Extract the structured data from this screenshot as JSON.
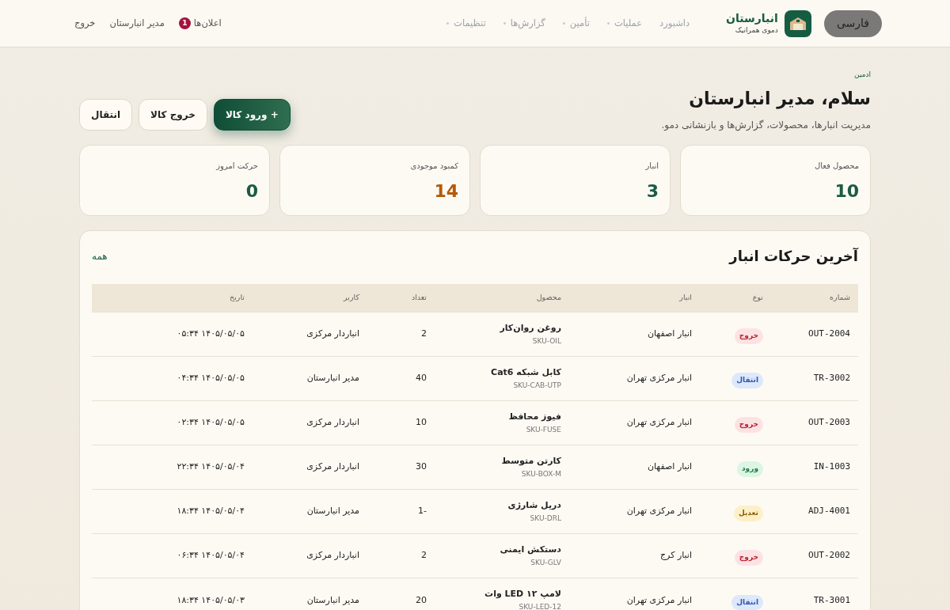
{
  "header": {
    "language_button": "فارسی",
    "brand": {
      "name": "انبارستان",
      "subtitle": "دموی همرانیک"
    },
    "nav": [
      {
        "label": "داشبورد",
        "dropdown": false
      },
      {
        "label": "عملیات",
        "dropdown": true
      },
      {
        "label": "تأمین",
        "dropdown": true
      },
      {
        "label": "گزارش‌ها",
        "dropdown": true
      },
      {
        "label": "تنظیمات",
        "dropdown": true
      }
    ],
    "notifications": {
      "label": "اعلان‌ها",
      "count": "1"
    },
    "user": "مدیر انبارستان",
    "logout": "خروج"
  },
  "hero": {
    "eyebrow": "ادمین",
    "title": "سلام، مدیر انبارستان",
    "subtitle": "مدیریت انبارها، محصولات، گزارش‌ها و بازنشانی دمو.",
    "actions": [
      {
        "label": "+ ورود کالا",
        "kind": "primary"
      },
      {
        "label": "خروج کالا",
        "kind": "secondary"
      },
      {
        "label": "انتقال",
        "kind": "secondary"
      }
    ]
  },
  "stats": [
    {
      "label": "محصول فعال",
      "value": "10",
      "kind": "normal"
    },
    {
      "label": "انبار",
      "value": "3",
      "kind": "normal"
    },
    {
      "label": "کمبود موجودی",
      "value": "14",
      "kind": "warning"
    },
    {
      "label": "حرکت امروز",
      "value": "0",
      "kind": "normal"
    }
  ],
  "movements": {
    "title": "آخرین حرکات انبار",
    "all_link": "همه",
    "columns": [
      "شماره",
      "نوع",
      "انبار",
      "محصول",
      "تعداد",
      "کاربر",
      "تاریخ"
    ],
    "rows": [
      {
        "number": "OUT-2004",
        "type": "خروج",
        "kind": "out",
        "warehouse": "انبار اصفهان",
        "product": "روغن روان‌کار",
        "sku": "SKU-OIL",
        "qty": "2",
        "user": "انباردار مرکزی",
        "date": "۱۴۰۵/۰۵/۰۵ ۰۵:۳۴"
      },
      {
        "number": "TR-3002",
        "type": "انتقال",
        "kind": "transfer",
        "warehouse": "انبار مرکزی تهران",
        "product": "کابل شبکه Cat6",
        "sku": "SKU-CAB-UTP",
        "qty": "40",
        "user": "مدیر انبارستان",
        "date": "۱۴۰۵/۰۵/۰۵ ۰۴:۳۴"
      },
      {
        "number": "OUT-2003",
        "type": "خروج",
        "kind": "out",
        "warehouse": "انبار مرکزی تهران",
        "product": "فیوز محافظ",
        "sku": "SKU-FUSE",
        "qty": "10",
        "user": "انباردار مرکزی",
        "date": "۱۴۰۵/۰۵/۰۵ ۰۲:۳۴"
      },
      {
        "number": "IN-1003",
        "type": "ورود",
        "kind": "in",
        "warehouse": "انبار اصفهان",
        "product": "کارتن متوسط",
        "sku": "SKU-BOX-M",
        "qty": "30",
        "user": "انباردار مرکزی",
        "date": "۱۴۰۵/۰۵/۰۴ ۲۲:۳۴"
      },
      {
        "number": "ADJ-4001",
        "type": "تعدیل",
        "kind": "adjust",
        "warehouse": "انبار مرکزی تهران",
        "product": "دریل شارژی",
        "sku": "SKU-DRL",
        "qty": "-1",
        "user": "مدیر انبارستان",
        "date": "۱۴۰۵/۰۵/۰۴ ۱۸:۳۴"
      },
      {
        "number": "OUT-2002",
        "type": "خروج",
        "kind": "out",
        "warehouse": "انبار کرج",
        "product": "دستکش ایمنی",
        "sku": "SKU-GLV",
        "qty": "2",
        "user": "انباردار مرکزی",
        "date": "۱۴۰۵/۰۵/۰۴ ۰۶:۳۴"
      },
      {
        "number": "TR-3001",
        "type": "انتقال",
        "kind": "transfer",
        "warehouse": "انبار مرکزی تهران",
        "product": "لامپ LED ۱۲ وات",
        "sku": "SKU-LED-12",
        "qty": "20",
        "user": "مدیر انبارستان",
        "date": "۱۴۰۵/۰۵/۰۳ ۱۸:۳۴"
      }
    ]
  }
}
